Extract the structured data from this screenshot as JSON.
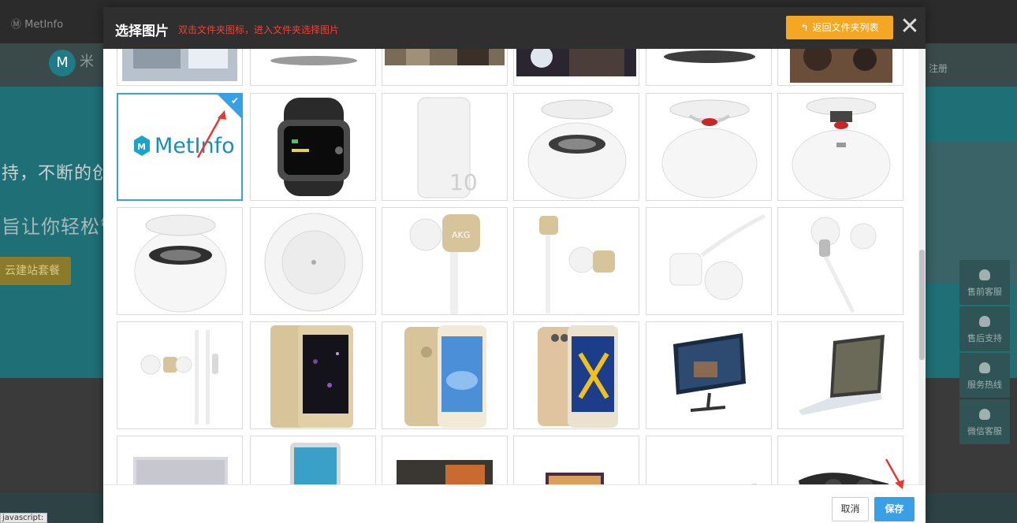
{
  "background": {
    "brand_top": "MetInfo",
    "brand_mark": "M",
    "brand_name": "米",
    "login_links": "注册",
    "hero_line1": "持，不断的创新",
    "hero_line2": "旨让你轻松管",
    "hero_button": "云建站套餐",
    "status_text": "javascript:",
    "side_panel": [
      {
        "label": "售前客服",
        "icon": "user-icon"
      },
      {
        "label": "售后支持",
        "icon": "user-icon"
      },
      {
        "label": "服务热线",
        "icon": "phone-icon"
      },
      {
        "label": "微信客服",
        "icon": "wechat-icon"
      }
    ]
  },
  "modal": {
    "title": "选择图片",
    "hint": "双击文件夹图标，进入文件夹选择图片",
    "back_button": "返回文件夹列表",
    "close_icon": "close-icon",
    "cancel_label": "取消",
    "save_label": "保存",
    "selected_logo_text": "MetInfo",
    "selected_logo_mark": "M"
  },
  "images": [
    {
      "name": "metinfo-logo",
      "selected": true
    },
    {
      "name": "smart-watch"
    },
    {
      "name": "power-bank"
    },
    {
      "name": "speaker-1"
    },
    {
      "name": "speaker-2"
    },
    {
      "name": "speaker-3"
    },
    {
      "name": "speaker-4"
    },
    {
      "name": "speaker-top-view"
    },
    {
      "name": "earphones-gold"
    },
    {
      "name": "earphones-gold-2"
    },
    {
      "name": "earphones-white"
    },
    {
      "name": "earphones-white-2"
    },
    {
      "name": "earphones-set"
    },
    {
      "name": "phone-gold-1"
    },
    {
      "name": "phone-gold-2"
    },
    {
      "name": "phone-gold-3"
    },
    {
      "name": "monitor"
    },
    {
      "name": "laptop"
    }
  ],
  "colors": {
    "accent": "#3aa0e6",
    "warning": "#f5a623",
    "hint": "#e8443a",
    "header": "#2f2f2f"
  }
}
